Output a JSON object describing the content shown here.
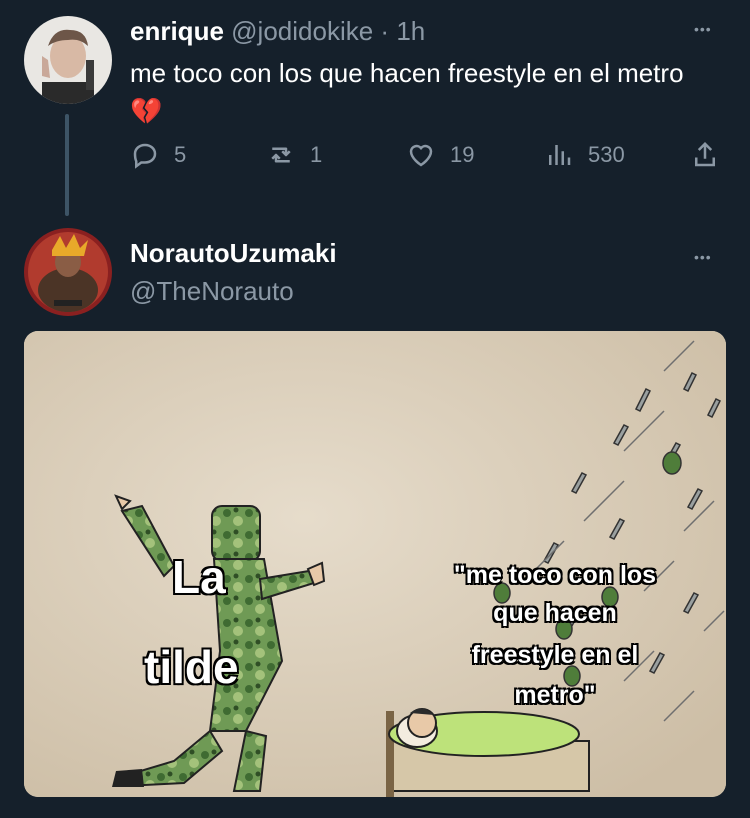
{
  "tweet1": {
    "name": "enrique",
    "handle": "@jodidokike",
    "separator": "·",
    "time": "1h",
    "text": "me toco con los que hacen freestyle en el metro",
    "emoji": "💔",
    "more": "•••",
    "actions": {
      "replies": "5",
      "retweets": "1",
      "likes": "19",
      "views": "530"
    }
  },
  "tweet2": {
    "name": "NorautoUzumaki",
    "handle": "@TheNorauto",
    "more": "•••",
    "meme": {
      "left_label": "La\ntilde",
      "left_label_line1": "La",
      "left_label_line2": "tilde",
      "right_label_line1": "\"me toco con los",
      "right_label_line2": "que hacen",
      "right_label_line3": "freestyle en el",
      "right_label_line4": "metro\""
    }
  },
  "colors": {
    "background": "#15202b",
    "secondary_text": "#8b98a5",
    "thread_line": "#3d5466",
    "meme_bg": "#dfd2bd"
  }
}
